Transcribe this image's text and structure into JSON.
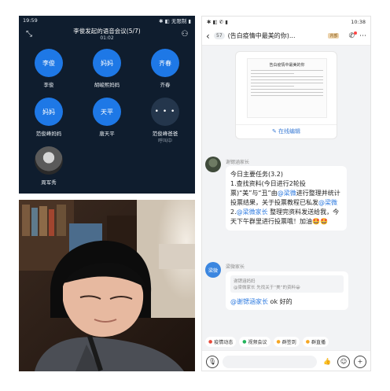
{
  "meeting": {
    "status_time": "19:59",
    "status_right": "✱ ◧ 无限制 ▮",
    "title": "李俊发起的语音会议(5/7)",
    "duration": "01:02",
    "participants": [
      {
        "avatar_text": "李俊",
        "name": "李俊",
        "sub": ""
      },
      {
        "avatar_text": "妈妈",
        "name": "胡峻熙妈妈",
        "sub": ""
      },
      {
        "avatar_text": "齐春",
        "name": "齐春",
        "sub": ""
      },
      {
        "avatar_text": "妈妈",
        "name": "范俊峰妈妈",
        "sub": ""
      },
      {
        "avatar_text": "天平",
        "name": "唐天平",
        "sub": ""
      },
      {
        "avatar_text": "• • •",
        "name": "范俊峰爸爸",
        "sub": "呼叫中"
      },
      {
        "avatar_text": "",
        "name": "周军秀",
        "sub": ""
      }
    ],
    "colors": {
      "background": "#0f1d2e",
      "avatar": "#1e78e6"
    }
  },
  "chat": {
    "status_time": "10:38",
    "status_right": "✱ ◧ ✆ ▮",
    "member_count": "57",
    "title": "(告白疫情中最美的你)...",
    "title_tag": "内部",
    "doc_card": {
      "title": "告白疫情中最美的你",
      "link_label": "在线编辑"
    },
    "messages": [
      {
        "sender": "谢锶涵家长",
        "segments": [
          {
            "text": "今日主要任务(3.2)",
            "type": "text"
          },
          {
            "text": "1.查找资料(今日进行2轮投票)“美”与“丑”由",
            "type": "text"
          },
          {
            "text": "@梁微",
            "type": "mention"
          },
          {
            "text": "进行整理并统计投票结果，关于投票教程已私发",
            "type": "text"
          },
          {
            "text": "@梁微",
            "type": "mention"
          },
          {
            "text": "2.",
            "type": "text"
          },
          {
            "text": "@梁微家长",
            "type": "mention"
          },
          {
            "text": " 整理完资料发送给我，今天下午群里进行投票哦！加油🤩🤩",
            "type": "text"
          }
        ]
      },
      {
        "sender": "梁微家长",
        "avatar_text": "梁微",
        "quote_sender": "谢锶涵妈妈",
        "quote_text": "@梁微家长 先找关于“美”的资料😀",
        "mention": "@谢锶涵家长",
        "reply": " ok 好的"
      }
    ],
    "toolbar": [
      {
        "icon": "●",
        "label": "疫情动态",
        "icon_color": "#e64a3b"
      },
      {
        "icon": "●",
        "label": "视频会议",
        "icon_color": "#23b45c"
      },
      {
        "icon": "●",
        "label": "群签到",
        "icon_color": "#f5a623"
      },
      {
        "icon": "●",
        "label": "群直播",
        "icon_color": "#f5a623"
      }
    ],
    "colors": {
      "link": "#3a7bd5",
      "mention": "#2f7be0",
      "background": "#f2f3f5"
    }
  }
}
